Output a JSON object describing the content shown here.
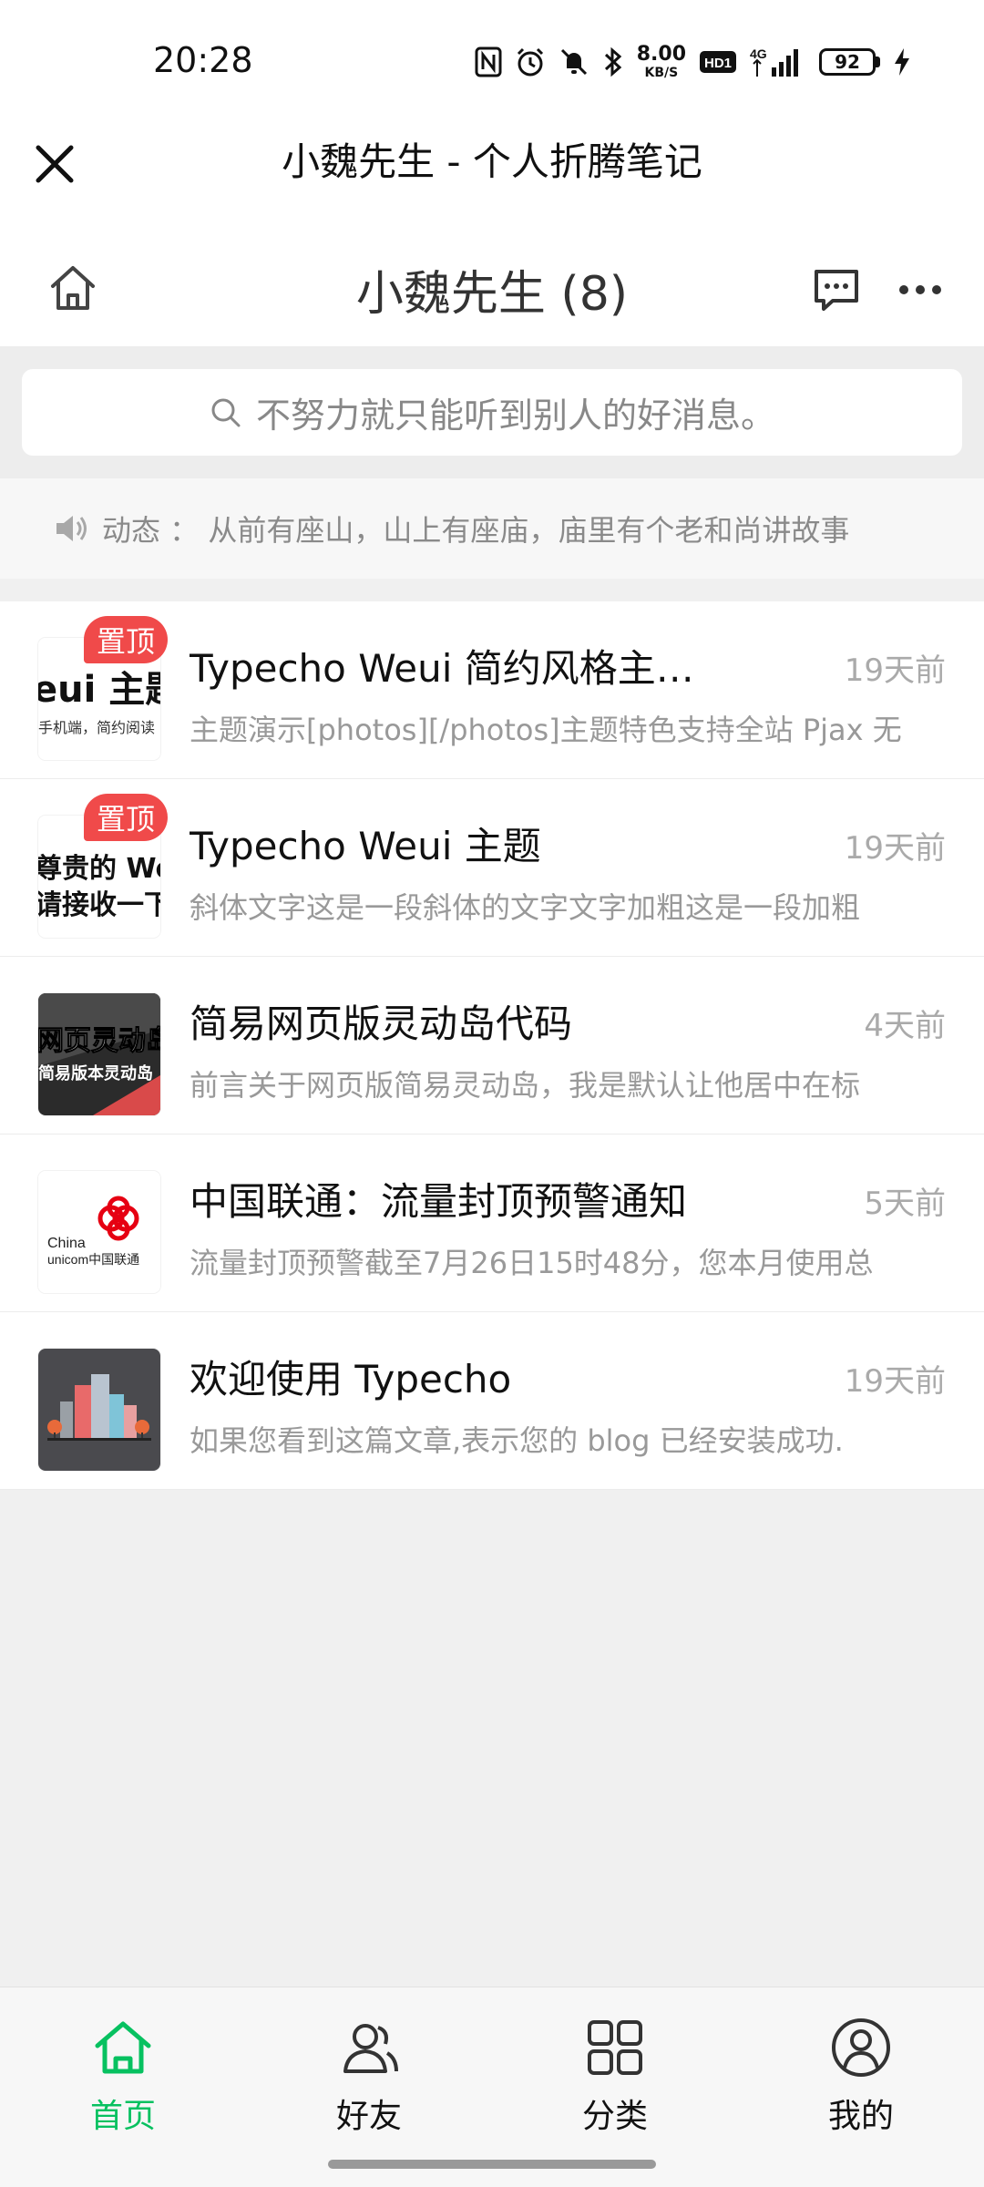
{
  "status_bar": {
    "time": "20:28",
    "net_speed_value": "8.00",
    "net_speed_unit": "KB/S",
    "hd_label": "HD1",
    "network_label": "4G",
    "battery": "92"
  },
  "title_bar": {
    "title": "小魏先生 - 个人折腾笔记"
  },
  "header": {
    "title": "小魏先生 (8)"
  },
  "search": {
    "placeholder": "不努力就只能听到别人的好消息。"
  },
  "notice": {
    "text": "动态 ： 从前有座山，山上有座庙，庙里有个老和尚讲故事"
  },
  "posts": [
    {
      "title": "Typecho Weui 简约风格主…",
      "time": "19天前",
      "excerpt": "主题演示[photos][/photos]主题特色支持全站 Pjax 无",
      "pinned": true,
      "badge": "置顶",
      "thumb_text_1": "eui 主题",
      "thumb_text_2": "手机端，简约阅读"
    },
    {
      "title": "Typecho Weui 主题",
      "time": "19天前",
      "excerpt": "斜体文字这是一段斜体的文字文字加粗这是一段加粗",
      "pinned": true,
      "badge": "置顶",
      "thumb_text_1": "尊贵的 We",
      "thumb_text_2": "请接收一下"
    },
    {
      "title": "简易网页版灵动岛代码",
      "time": "4天前",
      "excerpt": "前言关于网页版简易灵动岛，我是默认让他居中在标",
      "pinned": false,
      "thumb_text_1": "网页灵动岛",
      "thumb_text_2": "简易版本灵动岛"
    },
    {
      "title": "中国联通：流量封顶预警通知",
      "time": "5天前",
      "excerpt": "流量封顶预警截至7月26日15时48分，您本月使用总",
      "pinned": false,
      "thumb_text_1": "China",
      "thumb_text_2": "unicom中国联通"
    },
    {
      "title": "欢迎使用 Typecho",
      "time": "19天前",
      "excerpt": "如果您看到这篇文章,表示您的 blog 已经安装成功.",
      "pinned": false
    }
  ],
  "tabs": [
    {
      "label": "首页",
      "icon": "home-icon",
      "active": true
    },
    {
      "label": "好友",
      "icon": "friends-icon",
      "active": false
    },
    {
      "label": "分类",
      "icon": "category-icon",
      "active": false
    },
    {
      "label": "我的",
      "icon": "profile-icon",
      "active": false
    }
  ],
  "colors": {
    "accent": "#07c160",
    "badge": "#f04a4a",
    "background": "#f0f0f0"
  }
}
